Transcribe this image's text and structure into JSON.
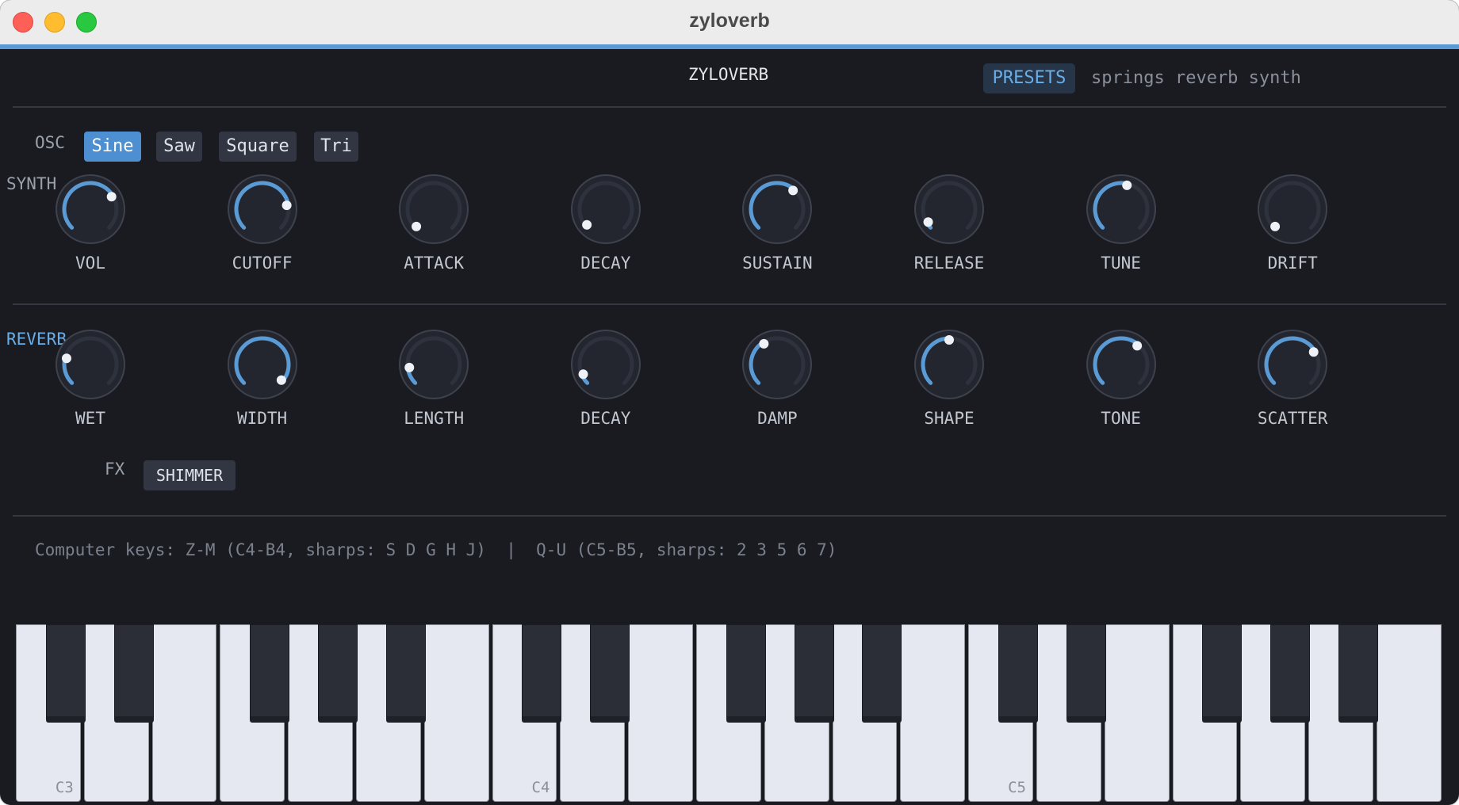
{
  "window": {
    "title": "zyloverb"
  },
  "header": {
    "brand": "ZYLOVERB",
    "presets_label": "PRESETS",
    "preset_name": "springs reverb synth"
  },
  "synth": {
    "label": "SYNTH",
    "osc_label": "OSC",
    "osc_options": [
      "Sine",
      "Saw",
      "Square",
      "Tri"
    ],
    "osc_selected": "Sine",
    "knobs": [
      {
        "label": "VOL",
        "value": 0.72
      },
      {
        "label": "CUTOFF",
        "value": 0.8
      },
      {
        "label": "ATTACK",
        "value": 0.0
      },
      {
        "label": "DECAY",
        "value": 0.02
      },
      {
        "label": "SUSTAIN",
        "value": 0.65
      },
      {
        "label": "RELEASE",
        "value": 0.05
      },
      {
        "label": "TUNE",
        "value": 0.55
      },
      {
        "label": "DRIFT",
        "value": 0.0
      }
    ]
  },
  "reverb": {
    "label": "REVERB",
    "knobs": [
      {
        "label": "WET",
        "value": 0.22
      },
      {
        "label": "WIDTH",
        "value": 0.98
      },
      {
        "label": "LENGTH",
        "value": 0.14
      },
      {
        "label": "DECAY",
        "value": 0.08
      },
      {
        "label": "DAMP",
        "value": 0.38
      },
      {
        "label": "SHAPE",
        "value": 0.5
      },
      {
        "label": "TONE",
        "value": 0.65
      },
      {
        "label": "SCATTER",
        "value": 0.72
      }
    ]
  },
  "fx": {
    "label": "FX",
    "button_label": "SHIMMER"
  },
  "keyboard": {
    "hint": "Computer keys: Z-M (C4-B4, sharps: S D G H J)  |  Q-U (C5-B5, sharps: 2 3 5 6 7)",
    "octave_labels": [
      "C3",
      "C4",
      "C5"
    ]
  },
  "colors": {
    "accent": "#5b9bd5",
    "background": "#191b21",
    "knob_arc": "#5b9bd5",
    "knob_track": "#2e323d"
  }
}
